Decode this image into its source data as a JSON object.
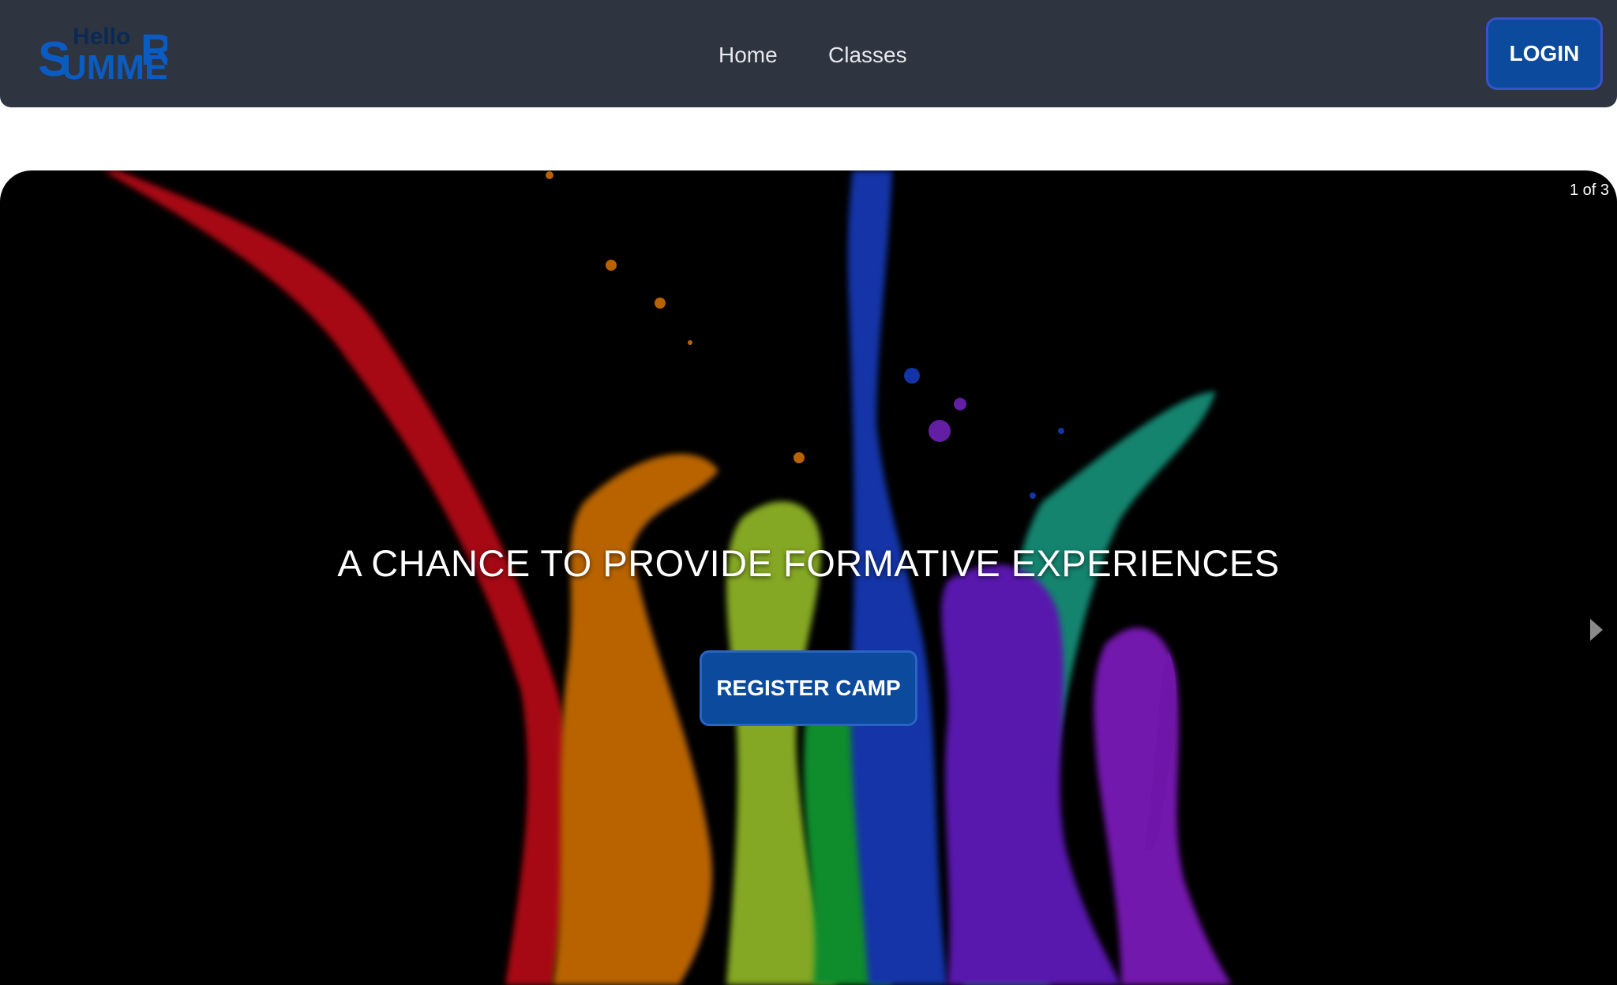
{
  "header": {
    "logo": {
      "icon": "hello-summer-logo",
      "text_top": "Hello",
      "text_main": "SUMMER"
    },
    "nav": [
      {
        "label": "Home"
      },
      {
        "label": "Classes"
      }
    ],
    "login_label": "LOGIN"
  },
  "carousel": {
    "counter": "1 of 3",
    "title": "A CHANCE TO PROVIDE FORMATIVE EXPERIENCES",
    "cta_label": "REGISTER CAMP",
    "next_icon": "chevron-right-icon",
    "image": "paint-splash-image"
  },
  "colors": {
    "navbar": "#2e3440",
    "primary_button": "#0b4a9c",
    "hero_background": "#000000"
  }
}
